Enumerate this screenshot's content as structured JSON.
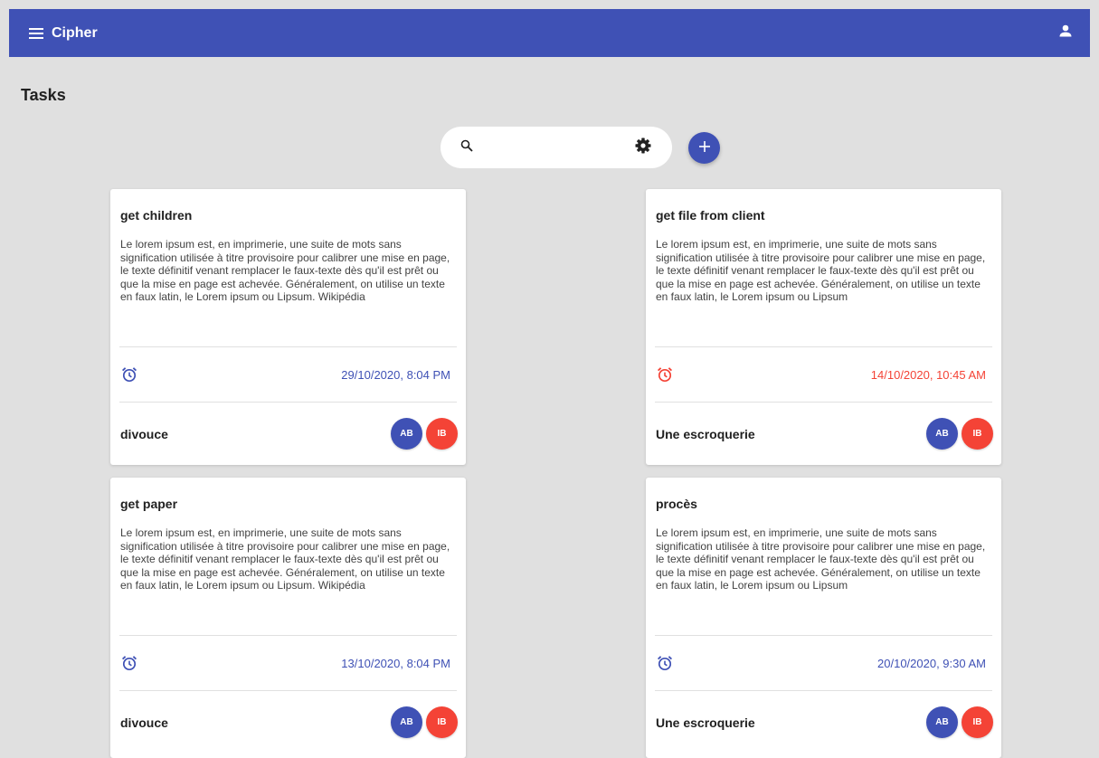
{
  "colors": {
    "primary": "#3f51b5",
    "danger": "#f44336",
    "due_normal": "#3f51b5",
    "due_overdue": "#f44336",
    "avatar_ab": "#3f51b5",
    "avatar_ib": "#f44336"
  },
  "header": {
    "app_title": "Cipher",
    "menu_icon": "menu-icon",
    "account_icon": "account-icon"
  },
  "page": {
    "title": "Tasks"
  },
  "toolbar": {
    "search_value": "",
    "search_placeholder": "",
    "search_icon": "search-icon",
    "settings_icon": "gear-icon",
    "add_icon": "plus-icon"
  },
  "tasks": [
    {
      "title": "get children",
      "description": "Le lorem ipsum est, en imprimerie, une suite de mots sans signification utilisée à titre provisoire pour calibrer une mise en page, le texte définitif venant remplacer le faux-texte dès qu'il est prêt ou que la mise en page est achevée. Généralement, on utilise un texte en faux latin, le Lorem ipsum ou Lipsum. Wikipédia",
      "due": "29/10/2020, 8:04 PM",
      "overdue": false,
      "tag": "divouce",
      "assignees": [
        "AB",
        "IB"
      ]
    },
    {
      "title": "get file from client",
      "description": "Le lorem ipsum est, en imprimerie, une suite de mots sans signification utilisée à titre provisoire pour calibrer une mise en page, le texte définitif venant remplacer le faux-texte dès qu'il est prêt ou que la mise en page est achevée. Généralement, on utilise un texte en faux latin, le Lorem ipsum ou Lipsum",
      "due": "14/10/2020, 10:45 AM",
      "overdue": true,
      "tag": "Une escroquerie",
      "assignees": [
        "AB",
        "IB"
      ]
    },
    {
      "title": "get paper",
      "description": "Le lorem ipsum est, en imprimerie, une suite de mots sans signification utilisée à titre provisoire pour calibrer une mise en page, le texte définitif venant remplacer le faux-texte dès qu'il est prêt ou que la mise en page est achevée. Généralement, on utilise un texte en faux latin, le Lorem ipsum ou Lipsum. Wikipédia",
      "due": "13/10/2020, 8:04 PM",
      "overdue": false,
      "tag": "divouce",
      "assignees": [
        "AB",
        "IB"
      ]
    },
    {
      "title": "procès",
      "description": "Le lorem ipsum est, en imprimerie, une suite de mots sans signification utilisée à titre provisoire pour calibrer une mise en page, le texte définitif venant remplacer le faux-texte dès qu'il est prêt ou que la mise en page est achevée. Généralement, on utilise un texte en faux latin, le Lorem ipsum ou Lipsum",
      "due": "20/10/2020, 9:30 AM",
      "overdue": false,
      "tag": "Une escroquerie",
      "assignees": [
        "AB",
        "IB"
      ]
    }
  ]
}
